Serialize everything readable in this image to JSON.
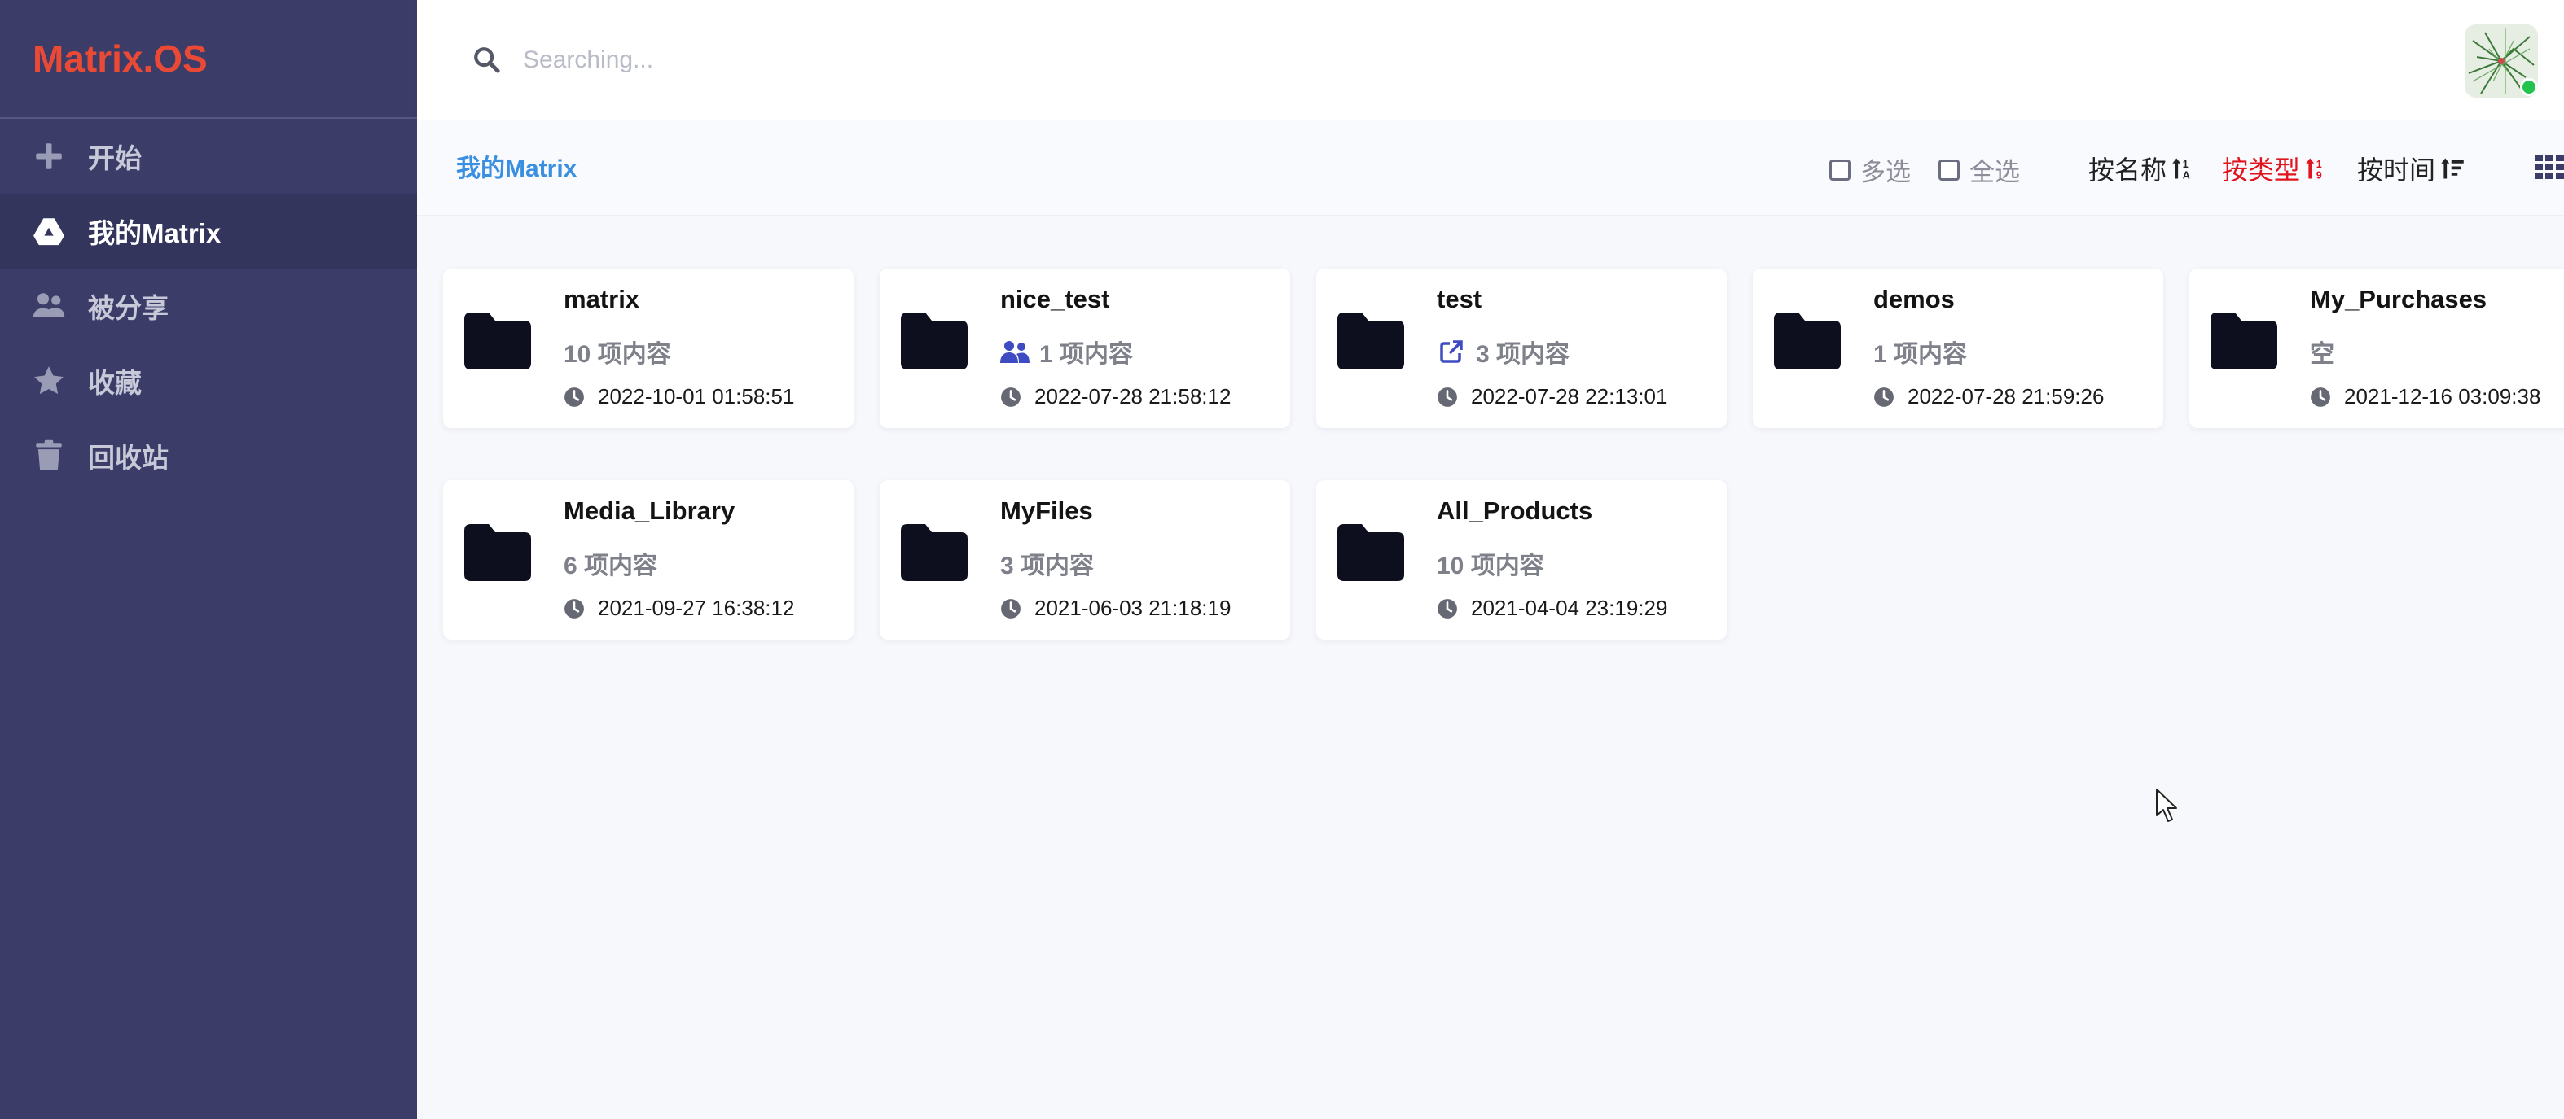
{
  "app": {
    "logo": "Matrix.OS"
  },
  "sidebar": {
    "items": [
      {
        "label": "开始",
        "icon": "plus-icon"
      },
      {
        "label": "我的Matrix",
        "icon": "drive-icon",
        "active": true
      },
      {
        "label": "被分享",
        "icon": "users-icon"
      },
      {
        "label": "收藏",
        "icon": "star-icon"
      },
      {
        "label": "回收站",
        "icon": "trash-icon"
      }
    ]
  },
  "search": {
    "placeholder": "Searching..."
  },
  "toolbar": {
    "breadcrumb": "我的Matrix",
    "multi_select": "多选",
    "select_all": "全选",
    "sort_by_name": "按名称",
    "sort_by_type": "按类型",
    "sort_by_time": "按时间",
    "active_sort": "按类型",
    "view_mode": "grid-icon"
  },
  "folders": [
    {
      "name": "matrix",
      "count": "10 项内容",
      "time": "2022-10-01 01:58:51",
      "badge": null
    },
    {
      "name": "nice_test",
      "count": "1 项内容",
      "time": "2022-07-28 21:58:12",
      "badge": "shared-users-icon"
    },
    {
      "name": "test",
      "count": "3 项内容",
      "time": "2022-07-28 22:13:01",
      "badge": "external-link-icon"
    },
    {
      "name": "demos",
      "count": "1 项内容",
      "time": "2022-07-28 21:59:26",
      "badge": null
    },
    {
      "name": "My_Purchases",
      "count": "空",
      "time": "2021-12-16 03:09:38",
      "badge": null
    },
    {
      "name": "Media_Library",
      "count": "6 项内容",
      "time": "2021-09-27 16:38:12",
      "badge": null
    },
    {
      "name": "MyFiles",
      "count": "3 项内容",
      "time": "2021-06-03 21:18:19",
      "badge": null
    },
    {
      "name": "All_Products",
      "count": "10 项内容",
      "time": "2021-04-04 23:19:29",
      "badge": null
    }
  ],
  "colors": {
    "sidebar_bg": "#3b3d68",
    "logo": "#ea4a35",
    "breadcrumb": "#3a8fe0",
    "active_sort": "#e0141c",
    "badge_icon": "#3f4bc2",
    "online": "#22c34d"
  }
}
